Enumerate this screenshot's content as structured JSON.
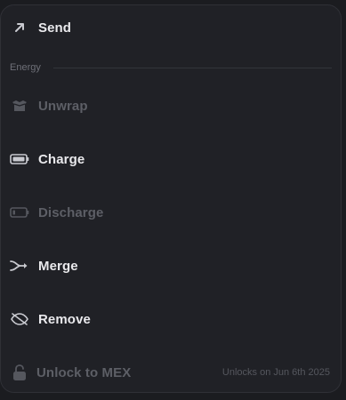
{
  "menu": {
    "send_label": "Send",
    "section_title": "Energy",
    "items": [
      {
        "label": "Unwrap",
        "icon": "box-icon",
        "enabled": false
      },
      {
        "label": "Charge",
        "icon": "battery-full-icon",
        "enabled": true
      },
      {
        "label": "Discharge",
        "icon": "battery-low-icon",
        "enabled": false
      },
      {
        "label": "Merge",
        "icon": "merge-icon",
        "enabled": true
      },
      {
        "label": "Remove",
        "icon": "eye-off-icon",
        "enabled": true
      }
    ],
    "unlock": {
      "label": "Unlock to MEX",
      "icon": "lock-icon",
      "note": "Unlocks on Jun 6th 2025",
      "enabled": false
    }
  },
  "colors": {
    "background": "#1b1c20",
    "panel": "#202126",
    "text_active": "#e9e9ec",
    "text_disabled": "#5d5f66",
    "icon_active": "#c9cad0",
    "icon_disabled": "#55575e"
  }
}
